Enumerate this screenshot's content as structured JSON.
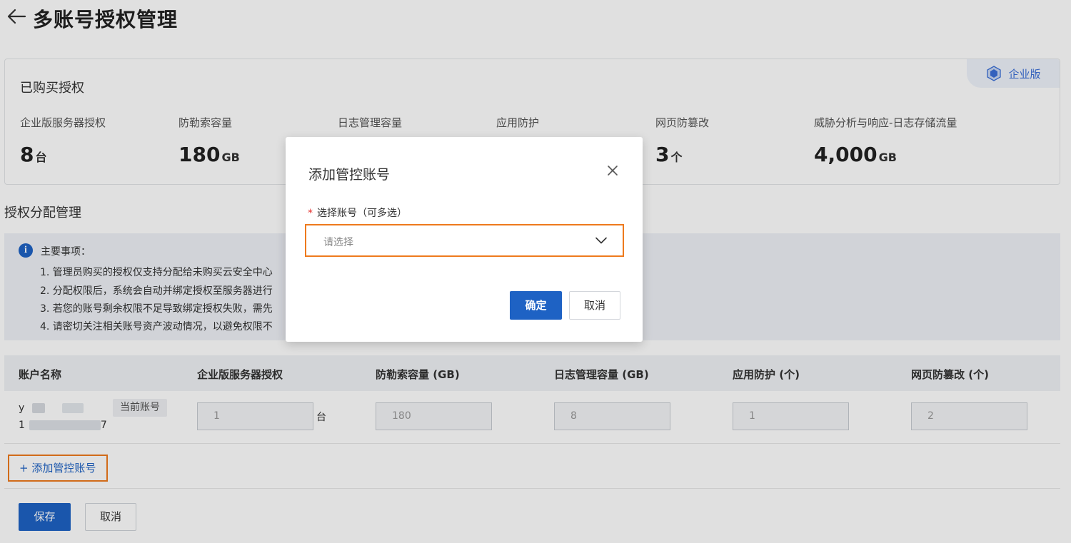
{
  "header": {
    "title": "多账号授权管理"
  },
  "purchased": {
    "title": "已购买授权",
    "edition_badge": "企业版",
    "stats": [
      {
        "label": "企业版服务器授权",
        "value": "8",
        "unit": "台"
      },
      {
        "label": "防勒索容量",
        "value": "180",
        "unit": "GB"
      },
      {
        "label": "日志管理容量",
        "value": "",
        "unit": ""
      },
      {
        "label": "应用防护",
        "value": "",
        "unit": ""
      },
      {
        "label": "网页防篡改",
        "value": "3",
        "unit": "个"
      },
      {
        "label": "威胁分析与响应-日志存储流量",
        "value": "4,000",
        "unit": "GB"
      }
    ]
  },
  "allocation": {
    "title": "授权分配管理",
    "notice": {
      "title": "主要事项：",
      "items": [
        "1. 管理员购买的授权仅支持分配给未购买云安全中心",
        "2. 分配权限后，系统会自动并绑定授权至服务器进行",
        "3. 若您的账号剩余权限不足导致绑定授权失败，需先",
        "4. 请密切关注相关账号资产波动情况，以避免权限不"
      ]
    },
    "table": {
      "headers": [
        "账户名称",
        "企业版服务器授权",
        "防勒索容量 (GB)",
        "日志管理容量 (GB)",
        "应用防护 (个)",
        "网页防篡改 (个)"
      ],
      "row": {
        "name_prefix": "y",
        "id_prefix": "1",
        "id_suffix": "7",
        "current_tag": "当前账号",
        "values": [
          "1",
          "180",
          "8",
          "1",
          "2"
        ],
        "server_unit": "台"
      }
    },
    "add_account": "+ 添加管控账号",
    "save": "保存",
    "cancel": "取消"
  },
  "modal": {
    "title": "添加管控账号",
    "required_mark": "*",
    "field_label": "选择账号（可多选）",
    "select_placeholder": "请选择",
    "ok": "确定",
    "cancel": "取消"
  },
  "colors": {
    "primary": "#1e62c4",
    "highlight": "#ee7a1d",
    "required": "#e5312e"
  }
}
